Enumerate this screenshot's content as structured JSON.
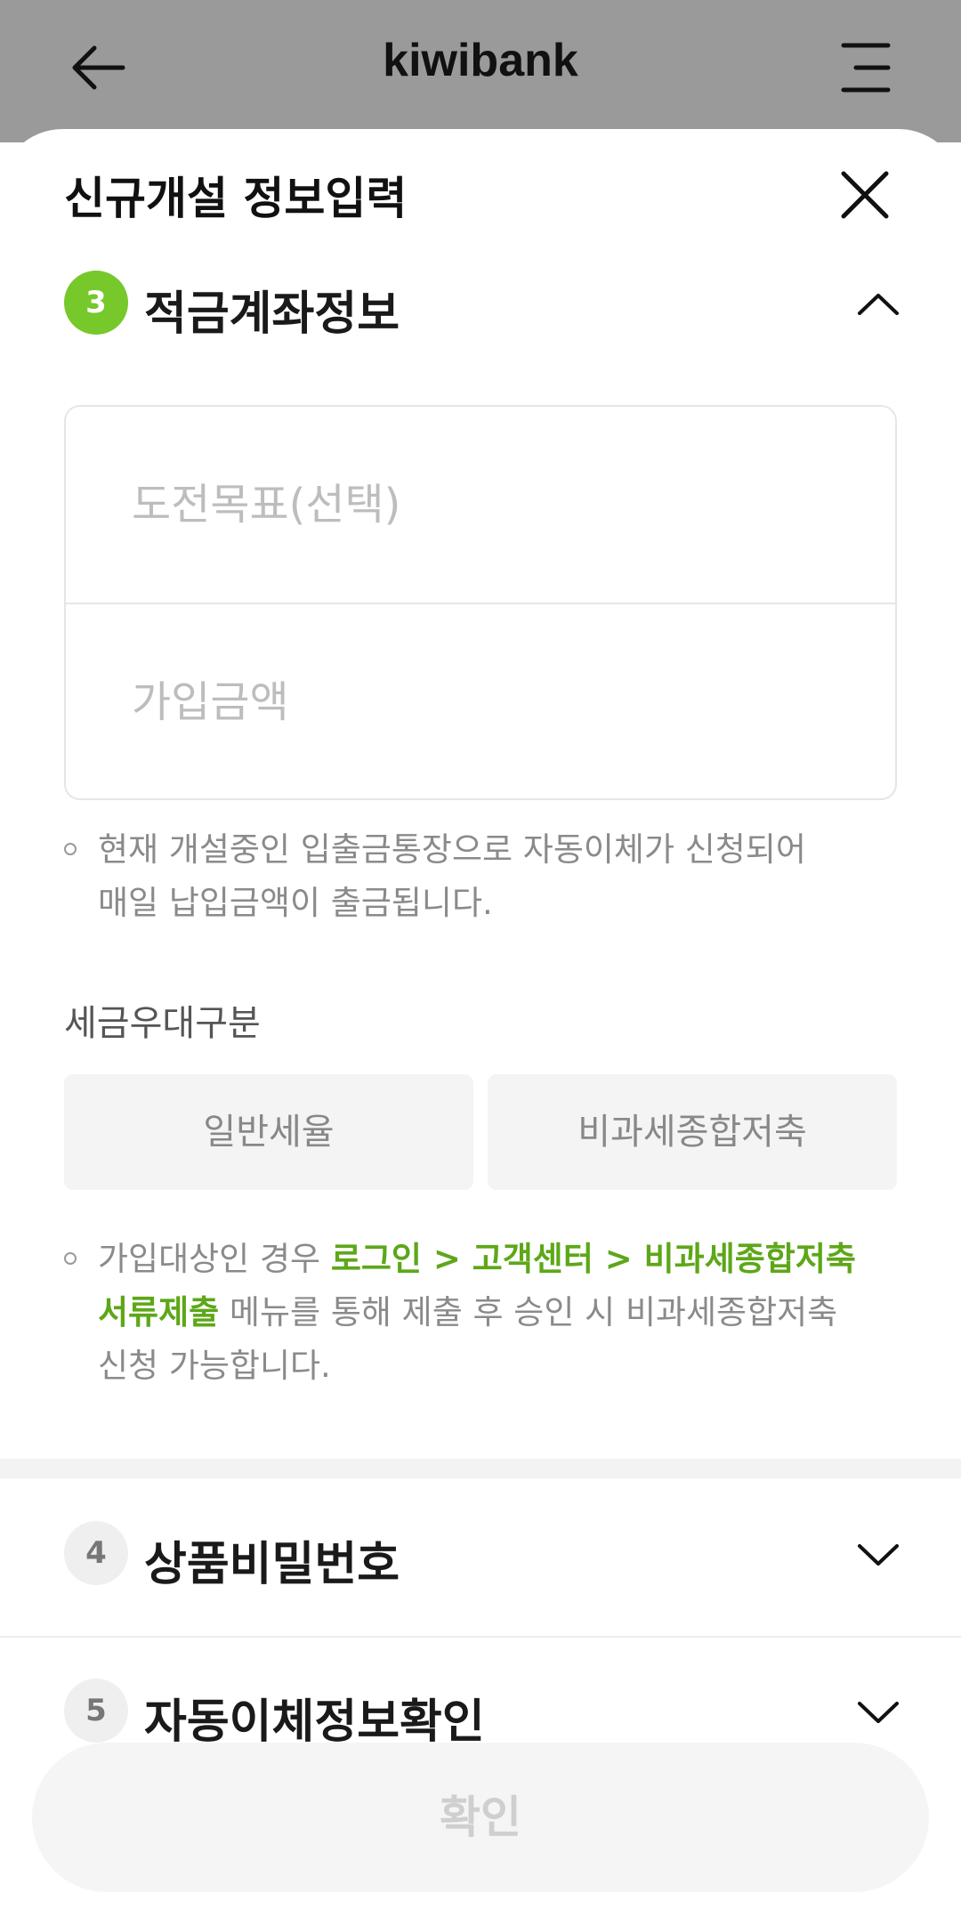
{
  "app": {
    "title": "kiwibank"
  },
  "sheet": {
    "title": "신규개설 정보입력"
  },
  "steps": [
    {
      "number": "3",
      "label": "적금계좌정보",
      "expanded": true
    },
    {
      "number": "4",
      "label": "상품비밀번호",
      "expanded": false
    },
    {
      "number": "5",
      "label": "자동이체정보확인",
      "expanded": false
    }
  ],
  "form": {
    "challenge_goal_placeholder": "도전목표(선택)",
    "amount_placeholder": "가입금액",
    "notice_line1": "현재 개설중인 입출금통장으로 자동이체가 신청되어",
    "notice_line2": "매일 납입금액이 출금됩니다.",
    "tax_section_label": "세금우대구분",
    "tax_options": [
      "일반세율",
      "비과세종합저축"
    ],
    "tax_note_prefix": "가입대상인 경우 ",
    "tax_note_link1": "로그인 > 고객센터 > 비과세종합저축",
    "tax_note_link2": "서류제출",
    "tax_note_mid": " 메뉴를 통해 제출 후 승인 시 비과세종합저축",
    "tax_note_end": "신청 가능합니다."
  },
  "confirm_label": "확인",
  "colors": {
    "accent": "#77c82a",
    "link": "#5da718",
    "header_bg": "#9a9a9a"
  },
  "icons": {
    "back": "back-arrow-icon",
    "menu": "menu-icon",
    "close": "close-icon",
    "expand": "chevron-up-icon",
    "collapse": "chevron-down-icon"
  }
}
